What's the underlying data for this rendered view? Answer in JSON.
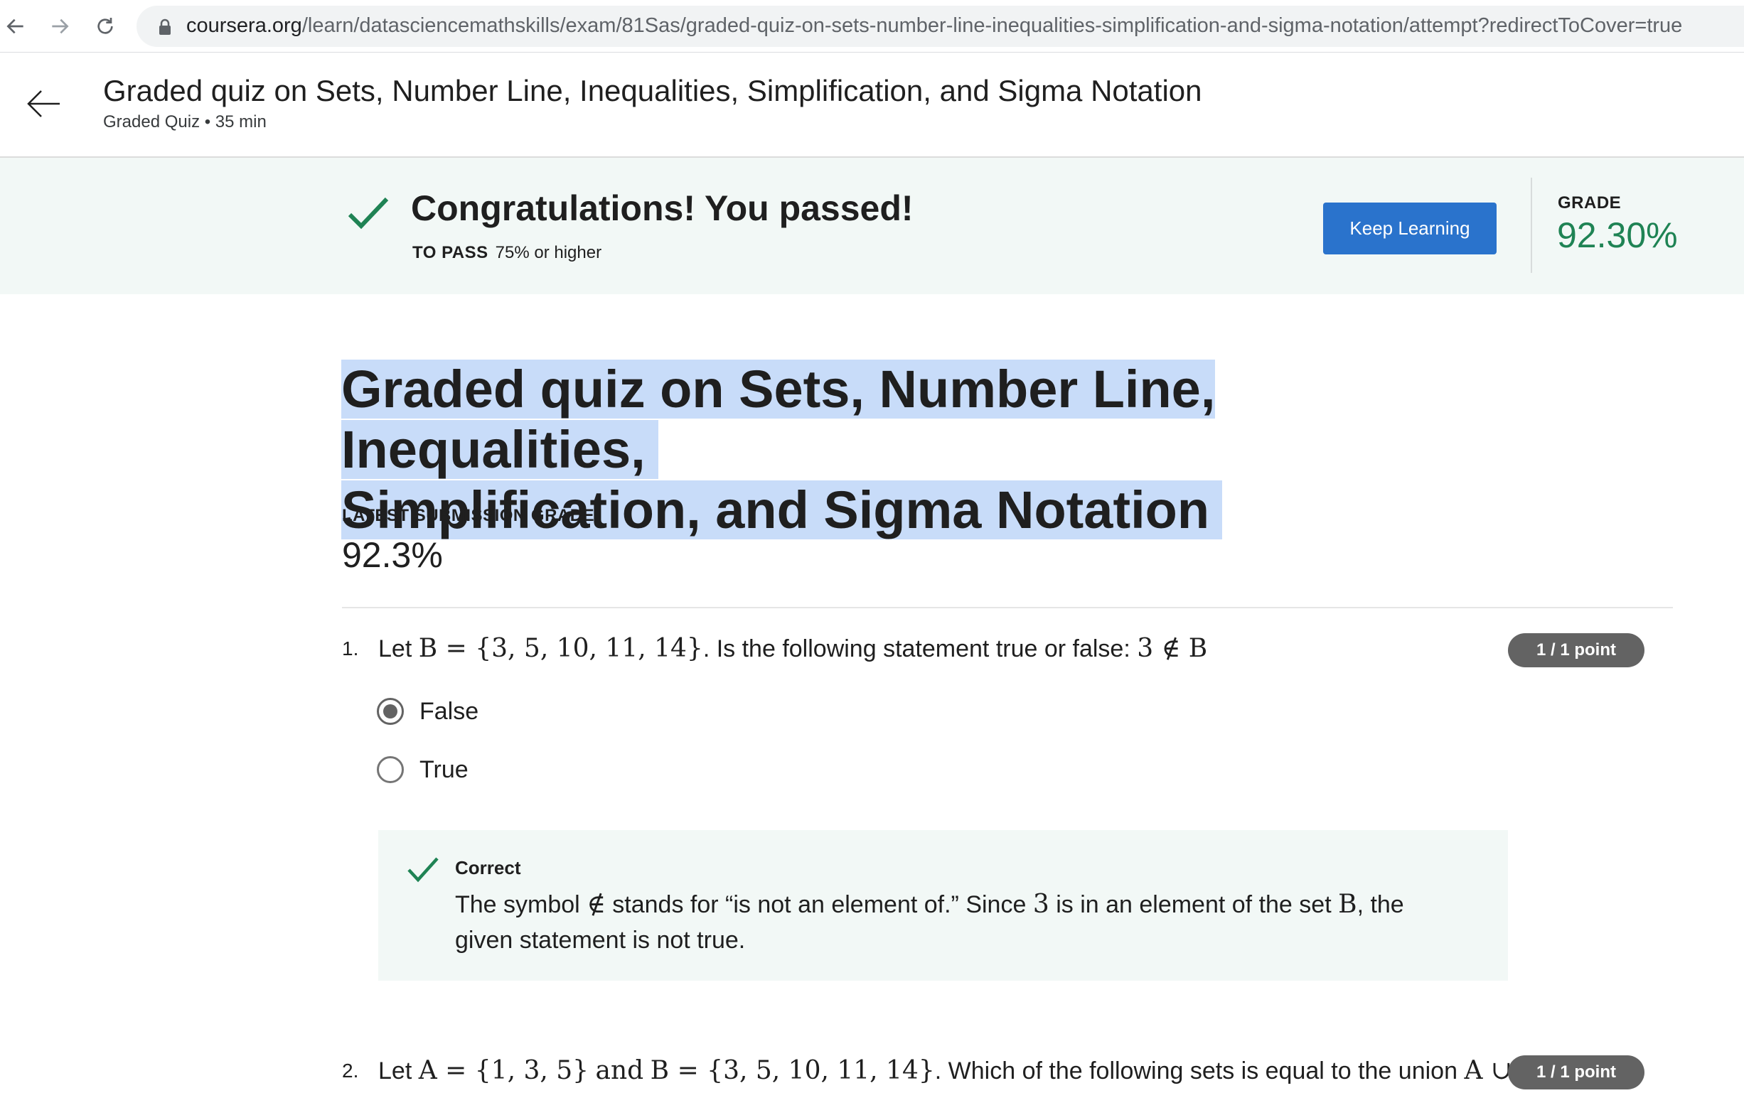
{
  "browser": {
    "url_host": "coursera.org",
    "url_path": "/learn/datasciencemathskills/exam/81Sas/graded-quiz-on-sets-number-line-inequalities-simplification-and-sigma-notation/attempt?redirectToCover=true"
  },
  "header": {
    "title": "Graded quiz on Sets, Number Line, Inequalities, Simplification, and Sigma Notation",
    "subtitle": "Graded Quiz • 35 min"
  },
  "banner": {
    "heading": "Congratulations! You passed!",
    "to_pass_label": "TO PASS",
    "to_pass_value": "75% or higher",
    "button_label": "Keep Learning",
    "grade_label": "GRADE",
    "grade_value": "92.30%",
    "accent_color": "#1f8354",
    "button_color": "#2a73cc"
  },
  "main": {
    "title_line1": "Graded quiz on Sets, Number Line, Inequalities,",
    "title_line2": "Simplification, and Sigma Notation",
    "latest_label": "LATEST SUBMISSION GRADE",
    "latest_value": "92.3%"
  },
  "questions": [
    {
      "number": "1.",
      "points": "1 / 1 point",
      "text_prefix": "Let",
      "text_math1": "B = {3, 5, 10, 11, 14}",
      "text_mid": ". Is the following statement true or false:",
      "text_math2": "3 ∉ B",
      "options": [
        {
          "label": "False",
          "selected": true
        },
        {
          "label": "True",
          "selected": false
        }
      ],
      "feedback": {
        "status": "Correct",
        "text_a": "The symbol",
        "math_a": "∉",
        "text_b": "stands for “is not an element of.” Since",
        "math_b": "3",
        "text_c": "is in an element of the set",
        "math_c": "B",
        "text_d": ", the given statement is not true."
      }
    },
    {
      "number": "2.",
      "points": "1 / 1 point",
      "text_prefix": "Let",
      "text_math1": "A = {1, 3, 5}",
      "text_and": "and",
      "text_math2": "B = {3, 5, 10, 11, 14}",
      "text_mid": ". Which of the following sets is equal to the union",
      "text_math3": "A ∪ B",
      "text_end": "?"
    }
  ]
}
